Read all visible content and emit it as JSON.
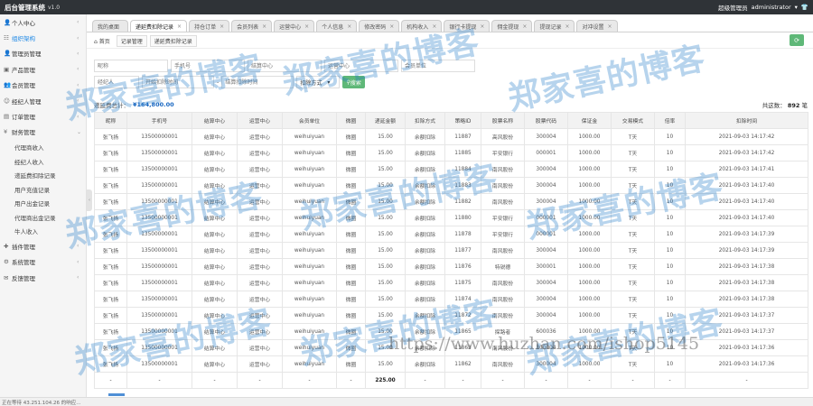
{
  "topbar": {
    "title": "后台管理系统",
    "version": "v1.0",
    "role": "超级管理员",
    "user": "administrator"
  },
  "sidebar": {
    "items": [
      {
        "label": "个人中心",
        "icon": "user-icon",
        "chev": "‹",
        "active": false
      },
      {
        "label": "组织架构",
        "icon": "org-icon",
        "chev": "‹",
        "active": true
      },
      {
        "label": "管理员管理",
        "icon": "admin-icon",
        "chev": "‹",
        "active": false
      },
      {
        "label": "产品管理",
        "icon": "product-icon",
        "chev": "‹",
        "active": false
      },
      {
        "label": "会员管理",
        "icon": "member-icon",
        "chev": "‹",
        "active": false
      },
      {
        "label": "经纪人管理",
        "icon": "broker-icon",
        "chev": "‹",
        "active": false
      },
      {
        "label": "订单管理",
        "icon": "order-icon",
        "chev": "‹",
        "active": false
      },
      {
        "label": "财务管理",
        "icon": "finance-icon",
        "chev": "⌄",
        "active": false
      }
    ],
    "finance_sub": [
      "代理商收入",
      "经纪人收入",
      "递延费扣除记录",
      "用户充值记录",
      "用户出金记录",
      "代理商出金记录",
      "牛人收入"
    ],
    "items_after": [
      {
        "label": "插件管理",
        "icon": "plugin-icon",
        "chev": "‹"
      },
      {
        "label": "系统管理",
        "icon": "system-icon",
        "chev": "‹"
      },
      {
        "label": "反馈管理",
        "icon": "feedback-icon",
        "chev": "‹"
      }
    ]
  },
  "tabs": [
    {
      "label": "我的桌面",
      "active": false,
      "close": ""
    },
    {
      "label": "递延费扣除记录",
      "active": true,
      "close": "×"
    },
    {
      "label": "持仓订单",
      "active": false,
      "close": "×"
    },
    {
      "label": "会员列表",
      "active": false,
      "close": "×"
    },
    {
      "label": "运营中心",
      "active": false,
      "close": "×"
    },
    {
      "label": "个人信息",
      "active": false,
      "close": "×"
    },
    {
      "label": "修改密码",
      "active": false,
      "close": "×"
    },
    {
      "label": "机构收入",
      "active": false,
      "close": "×"
    },
    {
      "label": "银行卡提现",
      "active": false,
      "close": "×"
    },
    {
      "label": "佣金提现",
      "active": false,
      "close": "×"
    },
    {
      "label": "提现记录",
      "active": false,
      "close": "×"
    },
    {
      "label": "对冲设置",
      "active": false,
      "close": "×"
    }
  ],
  "breadcrumb": {
    "home": "首页",
    "sep": "›",
    "items": [
      "记录管理",
      "递延费扣除记录"
    ]
  },
  "filters": {
    "row1": [
      "昵称",
      "手机号",
      "结算中心",
      "运营中心",
      "会员单位"
    ],
    "row2": {
      "name_ph": "经纪人",
      "start_ph": "开始扣除时间",
      "end_ph": "结算扣除时间",
      "dash": "-",
      "select": "扣除方式",
      "search": "搜索"
    }
  },
  "summary": {
    "label": "递延费总计：",
    "amount": "¥164,800.00",
    "count_label": "共这数：",
    "count": "892",
    "count_unit": "笔"
  },
  "table": {
    "headers": [
      "昵称",
      "手机号",
      "结算中心",
      "运营中心",
      "会员单位",
      "微圈",
      "递延金额",
      "扣除方式",
      "策略ID",
      "股票名称",
      "股票代码",
      "保证金",
      "交易模式",
      "倍率",
      "扣除时间"
    ],
    "rows": [
      [
        "张飞扬",
        "13500000001",
        "结算中心",
        "运营中心",
        "weihuiyuan",
        "微圈",
        "15.00",
        "余额扣除",
        "11887",
        "高风股份",
        "300004",
        "1000.00",
        "T天",
        "10",
        "2021-09-03 14:17:42"
      ],
      [
        "张飞扬",
        "13500000001",
        "结算中心",
        "运营中心",
        "weihuiyuan",
        "微圈",
        "15.00",
        "余额扣除",
        "11885",
        "平安银行",
        "000001",
        "1000.00",
        "T天",
        "10",
        "2021-09-03 14:17:42"
      ],
      [
        "张飞扬",
        "13500000001",
        "结算中心",
        "运营中心",
        "weihuiyuan",
        "微圈",
        "15.00",
        "余额扣除",
        "11884",
        "南风股份",
        "300004",
        "1000.00",
        "T天",
        "10",
        "2021-09-03 14:17:41"
      ],
      [
        "张飞扬",
        "13500000001",
        "结算中心",
        "运营中心",
        "weihuiyuan",
        "微圈",
        "15.00",
        "余额扣除",
        "11883",
        "南风股份",
        "300004",
        "1000.00",
        "T天",
        "10",
        "2021-09-03 14:17:40"
      ],
      [
        "张飞扬",
        "13500000001",
        "结算中心",
        "运营中心",
        "weihuiyuan",
        "微圈",
        "15.00",
        "余额扣除",
        "11882",
        "南风股份",
        "300004",
        "1000.00",
        "T天",
        "10",
        "2021-09-03 14:17:40"
      ],
      [
        "张飞扬",
        "13500000001",
        "结算中心",
        "运营中心",
        "weihuiyuan",
        "微圈",
        "15.00",
        "余额扣除",
        "11880",
        "平安银行",
        "000001",
        "1000.00",
        "T天",
        "10",
        "2021-09-03 14:17:40"
      ],
      [
        "张飞扬",
        "13500000001",
        "结算中心",
        "运营中心",
        "weihuiyuan",
        "微圈",
        "15.00",
        "余额扣除",
        "11878",
        "平安银行",
        "000001",
        "1000.00",
        "T天",
        "10",
        "2021-09-03 14:17:39"
      ],
      [
        "张飞扬",
        "13500000001",
        "结算中心",
        "运营中心",
        "weihuiyuan",
        "微圈",
        "15.00",
        "余额扣除",
        "11877",
        "南风股份",
        "300004",
        "1000.00",
        "T天",
        "10",
        "2021-09-03 14:17:39"
      ],
      [
        "张飞扬",
        "13500000001",
        "结算中心",
        "运营中心",
        "weihuiyuan",
        "微圈",
        "15.00",
        "余额扣除",
        "11876",
        "特锐德",
        "300001",
        "1000.00",
        "T天",
        "10",
        "2021-09-03 14:17:38"
      ],
      [
        "张飞扬",
        "13500000001",
        "结算中心",
        "运营中心",
        "weihuiyuan",
        "微圈",
        "15.00",
        "余额扣除",
        "11875",
        "南风股份",
        "300004",
        "1000.00",
        "T天",
        "10",
        "2021-09-03 14:17:38"
      ],
      [
        "张飞扬",
        "13500000001",
        "结算中心",
        "运营中心",
        "weihuiyuan",
        "微圈",
        "15.00",
        "余额扣除",
        "11874",
        "南风股份",
        "300004",
        "1000.00",
        "T天",
        "10",
        "2021-09-03 14:17:38"
      ],
      [
        "张飞扬",
        "13500000001",
        "结算中心",
        "运营中心",
        "weihuiyuan",
        "微圈",
        "15.00",
        "余额扣除",
        "11872",
        "南风股份",
        "300004",
        "1000.00",
        "T天",
        "10",
        "2021-09-03 14:17:37"
      ],
      [
        "张飞扬",
        "13500000001",
        "结算中心",
        "运营中心",
        "weihuiyuan",
        "微圈",
        "15.00",
        "余额扣除",
        "11865",
        "探路者",
        "600036",
        "1000.00",
        "T天",
        "10",
        "2021-09-03 14:17:37"
      ],
      [
        "张飞扬",
        "13500000001",
        "结算中心",
        "运营中心",
        "weihuiyuan",
        "微圈",
        "15.00",
        "余额扣除",
        "11863",
        "南风股份",
        "300004",
        "1000.00",
        "T天",
        "10",
        "2021-09-03 14:17:36"
      ],
      [
        "张飞扬",
        "13500000001",
        "结算中心",
        "运营中心",
        "weihuiyuan",
        "微圈",
        "15.00",
        "余额扣除",
        "11862",
        "南风股份",
        "300004",
        "1000.00",
        "T天",
        "10",
        "2021-09-03 14:17:36"
      ]
    ],
    "footer": [
      "-",
      "-",
      "-",
      "-",
      "-",
      "-",
      "225.00",
      "-",
      "-",
      "-",
      "-",
      "-",
      "-",
      "-",
      "-"
    ]
  },
  "statusbar": "正在等待 43.251.104.26 的响应...",
  "watermark": {
    "text": "郑家喜的博客",
    "url": "https://www.huzhan.com/ishop5145"
  }
}
